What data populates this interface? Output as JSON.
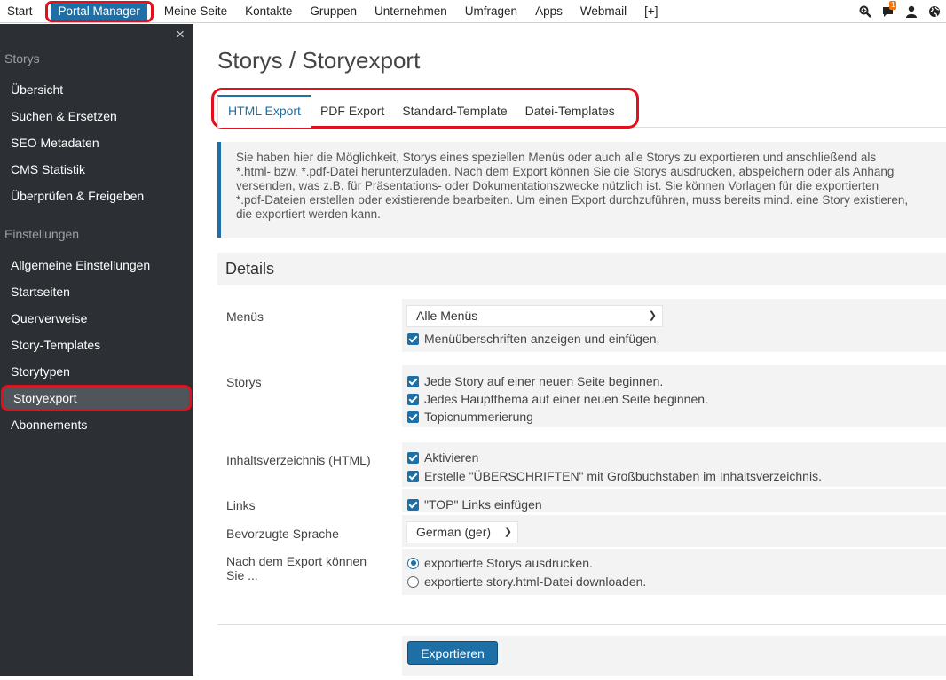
{
  "topnav": {
    "items": [
      "Start",
      "Portal Manager",
      "Meine Seite",
      "Kontakte",
      "Gruppen",
      "Unternehmen",
      "Umfragen",
      "Apps",
      "Webmail",
      "[+]"
    ],
    "notification_count": "1",
    "icons": [
      "search-icon",
      "chat-icon",
      "user-icon",
      "globe-icon"
    ]
  },
  "sidebar": {
    "close": "×",
    "section_storys": "Storys",
    "storys_items": [
      "Übersicht",
      "Suchen & Ersetzen",
      "SEO Metadaten",
      "CMS Statistik",
      "Überprüfen & Freigeben"
    ],
    "section_settings": "Einstellungen",
    "settings_items": [
      "Allgemeine Einstellungen",
      "Startseiten",
      "Querverweise",
      "Story-Templates",
      "Storytypen",
      "Storyexport",
      "Abonnements"
    ]
  },
  "main": {
    "title": "Storys / Storyexport",
    "tabs": [
      "HTML Export",
      "PDF Export",
      "Standard-Template",
      "Datei-Templates"
    ],
    "info_lines": [
      "Sie haben hier die Möglichkeit, Storys eines speziellen Menüs oder auch alle Storys zu exportieren und anschließend als",
      "*.html- bzw. *.pdf-Datei herunterzuladen. Nach dem Export können Sie die Storys ausdrucken, abspeichern oder als Anhang",
      "versenden, was z.B. für Präsentations- oder Dokumentationszwecke nützlich ist. Sie können Vorlagen für die exportierten",
      "*.pdf-Dateien erstellen oder existierende bearbeiten. Um einen Export durchzuführen, muss bereits mind. eine Story existieren,",
      "die exportiert werden kann."
    ],
    "details_heading": "Details",
    "menus": {
      "label": "Menüs",
      "select_value": "Alle Menüs",
      "checkbox": "Menüüberschriften anzeigen und einfügen."
    },
    "storys": {
      "label": "Storys",
      "checkboxes": [
        "Jede Story auf einer neuen Seite beginnen.",
        "Jedes Hauptthema auf einer neuen Seite beginnen.",
        "Topicnummerierung"
      ]
    },
    "toc": {
      "label": "Inhaltsverzeichnis (HTML)",
      "checkboxes": [
        "Aktivieren",
        "Erstelle \"ÜBERSCHRIFTEN\" mit Großbuchstaben im Inhaltsverzeichnis."
      ]
    },
    "links": {
      "label": "Links",
      "checkbox": "\"TOP\" Links einfügen"
    },
    "language": {
      "label": "Bevorzugte Sprache",
      "select_value": "German (ger)"
    },
    "after_export": {
      "label_line1": "Nach dem Export können",
      "label_line2": "Sie ...",
      "options": [
        "exportierte Storys ausdrucken.",
        "exportierte story.html-Datei downloaden."
      ],
      "selected": 0
    },
    "submit": "Exportieren"
  }
}
